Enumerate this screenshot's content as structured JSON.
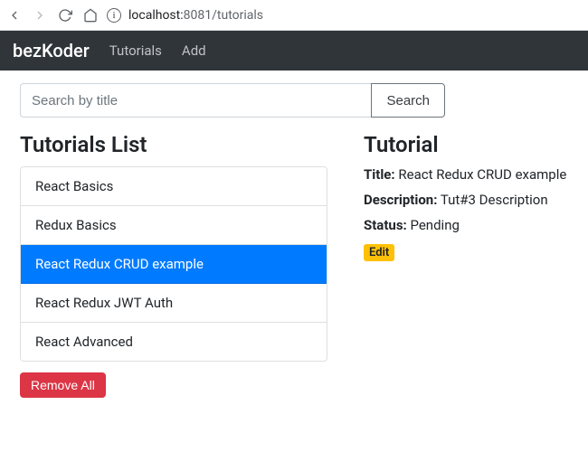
{
  "browser": {
    "url_host": "localhost:",
    "url_port_path": "8081/tutorials"
  },
  "navbar": {
    "brand": "bezKoder",
    "links": [
      "Tutorials",
      "Add"
    ]
  },
  "search": {
    "placeholder": "Search by title",
    "button": "Search"
  },
  "tutorials": {
    "heading": "Tutorials List",
    "items": [
      "React Basics",
      "Redux Basics",
      "React Redux CRUD example",
      "React Redux JWT Auth",
      "React Advanced"
    ],
    "active_index": 2,
    "remove_label": "Remove All"
  },
  "detail": {
    "heading": "Tutorial",
    "title_label": "Title:",
    "title_value": "React Redux CRUD example",
    "description_label": "Description:",
    "description_value": "Tut#3 Description",
    "status_label": "Status:",
    "status_value": "Pending",
    "edit_label": "Edit"
  }
}
